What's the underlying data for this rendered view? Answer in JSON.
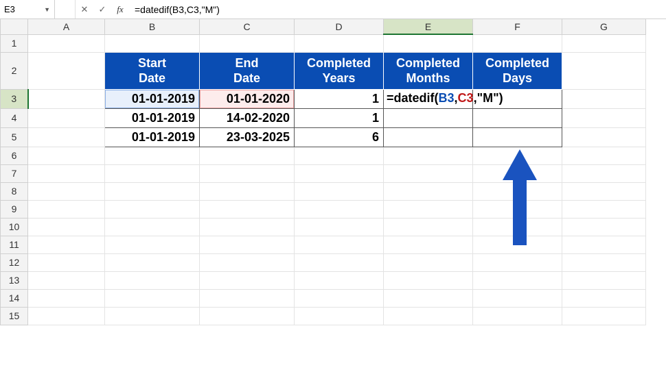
{
  "namebox": {
    "value": "E3"
  },
  "formula_bar": {
    "cancel_icon": "✕",
    "enter_icon": "✓",
    "fx_label": "fx",
    "formula": "=datedif(B3,C3,\"M\")"
  },
  "columns": [
    "A",
    "B",
    "C",
    "D",
    "E",
    "F",
    "G"
  ],
  "rows": [
    "1",
    "2",
    "3",
    "4",
    "5",
    "6",
    "7",
    "8",
    "9",
    "10",
    "11",
    "12",
    "13",
    "14",
    "15"
  ],
  "headers": {
    "B": "Start\nDate",
    "C": "End\nDate",
    "D": "Completed\nYears",
    "E": "Completed\nMonths",
    "F": "Completed\nDays"
  },
  "table": {
    "r3": {
      "B": "01-01-2019",
      "C": "01-01-2020",
      "D": "1"
    },
    "r4": {
      "B": "01-01-2019",
      "C": "14-02-2020",
      "D": "1"
    },
    "r5": {
      "B": "01-01-2019",
      "C": "23-03-2025",
      "D": "6"
    }
  },
  "editing_formula": {
    "prefix": "=datedif(",
    "ref1": "B3",
    "comma1": ",",
    "ref2": "C3",
    "comma2": ",",
    "arg": "\"M\"",
    "suffix": ")"
  }
}
